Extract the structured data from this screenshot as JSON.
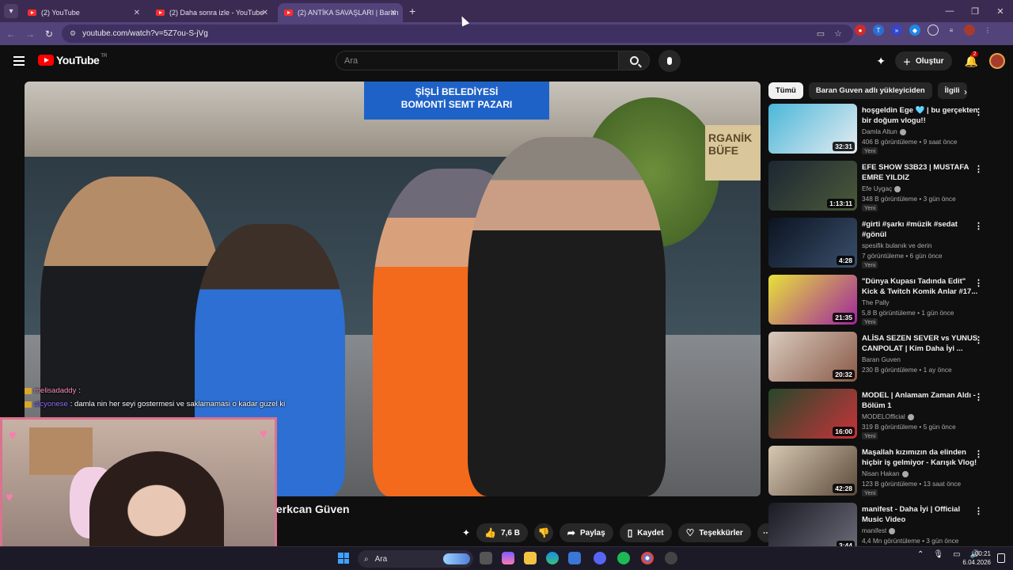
{
  "browser": {
    "tabs": [
      {
        "title": "(2) YouTube"
      },
      {
        "title": "(2) Daha sonra izle - YouTube"
      },
      {
        "title": "(2) ANTİKA SAVAŞLARI | Baran"
      }
    ],
    "url": "youtube.com/watch?v=5Z7ou-S-jVg"
  },
  "youtube": {
    "logo_text": "YouTube",
    "logo_region": "TR",
    "search_placeholder": "Ara",
    "create_label": "Oluştur",
    "notif_count": "2"
  },
  "video": {
    "banner_line1": "ŞİŞLİ BELEDİYESİ",
    "banner_line2": "BOMONTİ SEMT PAZARI",
    "shop_text": "RGANİK BÜFE",
    "title_fragment": "erkcan Güven",
    "chat": [
      {
        "user": "melisadaddy",
        "text": ":"
      },
      {
        "user": "alcyonese",
        "text": ": damla nin her seyi gostermesi ve saklamamasi o kadar guzel ki"
      }
    ],
    "actions": {
      "likes": "7,6 B",
      "share": "Paylaş",
      "save": "Kaydet",
      "thanks": "Teşekkürler"
    }
  },
  "sidebar": {
    "chips": [
      "Tümü",
      "Baran Guven adlı yükleyiciden",
      "İlgili"
    ],
    "recommendations": [
      {
        "title": "hoşgeldin Ege 🩵 | bu gerçekten bir doğum vlogu!!",
        "channel": "Damla Altun",
        "verified": true,
        "meta": "406 B görüntüleme • 9 saat önce",
        "badge": "Yeni",
        "duration": "32:31",
        "thumb": [
          "#4ab7d8",
          "#e6ecf2"
        ]
      },
      {
        "title": "EFE SHOW S3B23 | MUSTAFA EMRE YILDIZ",
        "channel": "Efe Uygaç",
        "verified": true,
        "meta": "348 B görüntüleme • 3 gün önce",
        "badge": "Yeni",
        "duration": "1:13:11",
        "thumb": [
          "#1c2632",
          "#4b5a3a"
        ]
      },
      {
        "title": "#girti #şarkı #müzik #sedat #gönül",
        "channel": "spesifik bulanık ve derin",
        "verified": false,
        "meta": "7 görüntüleme • 6 gün önce",
        "badge": "Yeni",
        "duration": "4:28",
        "thumb": [
          "#0b1320",
          "#3a4f6c"
        ]
      },
      {
        "title": "\"Dünya Kupası Tadında Edit\" Kick & Twitch Komik Anlar #17...",
        "channel": "The Pally",
        "verified": false,
        "meta": "5,8 B görüntüleme • 1 gün önce",
        "badge": "Yeni",
        "duration": "21:35",
        "thumb": [
          "#e8e23a",
          "#a0259e"
        ]
      },
      {
        "title": "ALİSA SEZEN SEVER vs YUNUS CANPOLAT | Kim Daha İyi ...",
        "channel": "Baran Guven",
        "verified": false,
        "meta": "230 B görüntüleme • 1 ay önce",
        "badge": "",
        "duration": "20:32",
        "thumb": [
          "#d8cabd",
          "#8a5a48"
        ]
      },
      {
        "title": "MODEL | Anlamam Zaman Aldı - Bölüm 1",
        "channel": "MODELOfficial",
        "verified": true,
        "meta": "319 B görüntüleme • 5 gün önce",
        "badge": "Yeni",
        "duration": "16:00",
        "thumb": [
          "#27482a",
          "#c8333a"
        ]
      },
      {
        "title": "Maşallah kızımızın da elinden hiçbir iş gelmiyor - Karışık Vlog!",
        "channel": "Nisan Hakan",
        "verified": true,
        "meta": "123 B görüntüleme • 13 saat önce",
        "badge": "Yeni",
        "duration": "42:28",
        "thumb": [
          "#d6c8b3",
          "#5c4a3a"
        ]
      },
      {
        "title": "manifest - Daha İyi | Official Music Video",
        "channel": "manifest",
        "verified": true,
        "meta": "4,4 Mn görüntüleme • 3 gün önce",
        "badge": "",
        "duration": "3:44",
        "thumb": [
          "#1a1a24",
          "#6c6c7a"
        ]
      }
    ]
  },
  "taskbar": {
    "search_label": "Ara",
    "time": "00:21",
    "date": "6.04.2026"
  },
  "colors": {
    "accent": "#ff0000",
    "browser_frame": "#52437a"
  }
}
